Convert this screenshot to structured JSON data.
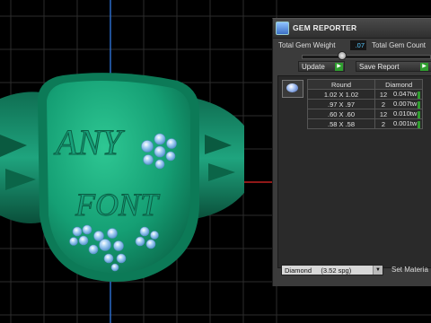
{
  "ring": {
    "engraving_line1": "ANY",
    "engraving_line2": "FONT",
    "metal_color": "#1f9e7a",
    "gem_color": "#8fc4ee"
  },
  "panel": {
    "title": "GEM REPORTER",
    "total_weight_label": "Total Gem Weight",
    "total_weight_value": ".07",
    "total_count_label": "Total Gem Count",
    "update_label": "Update",
    "save_report_label": "Save Report",
    "go_icon": "play-icon",
    "table": {
      "headers": [
        "Round",
        "Diamond"
      ],
      "rows": [
        {
          "size": "1.02 X 1.02",
          "count": "12",
          "weight": "0.047tw"
        },
        {
          "size": ".97 X .97",
          "count": "2",
          "weight": "0.007tw"
        },
        {
          "size": ".60 X .60",
          "count": "12",
          "weight": "0.010tw"
        },
        {
          "size": ".58 X .58",
          "count": "2",
          "weight": "0.001tw"
        }
      ]
    },
    "material_select": "Diamond     (3.52 spg)",
    "set_material_label": "Set Materia"
  }
}
